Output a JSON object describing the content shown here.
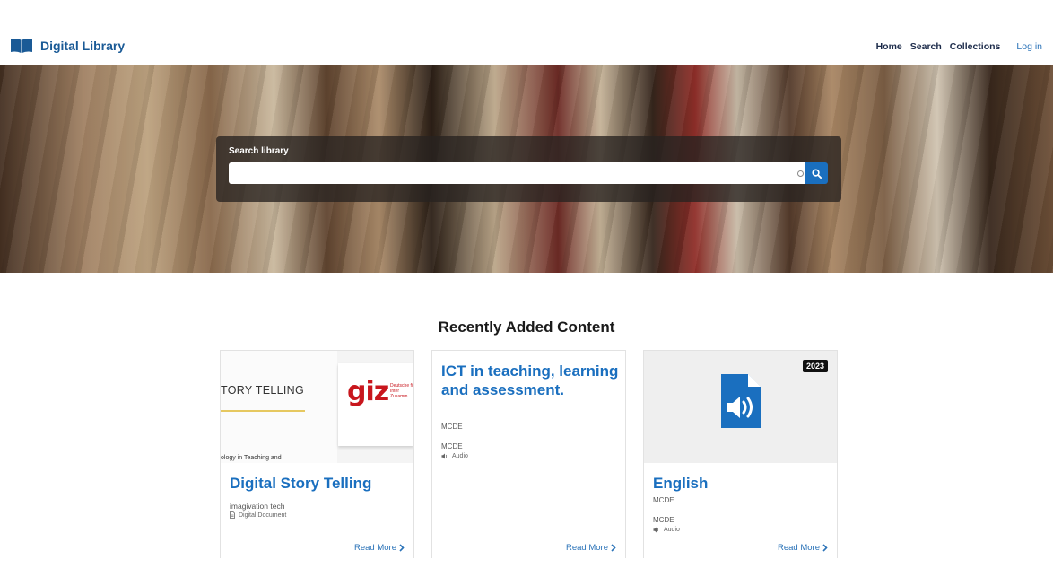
{
  "header": {
    "brand": "Digital Library",
    "nav": {
      "home": "Home",
      "search": "Search",
      "collections": "Collections",
      "login": "Log in"
    }
  },
  "hero": {
    "search_label": "Search library",
    "search_value": "",
    "search_placeholder": ""
  },
  "recent": {
    "title": "Recently Added Content",
    "cards": [
      {
        "thumb_text": "TORY TELLING",
        "thumb_logo": "giz",
        "thumb_logo_sub": "Deutsche für Inter Zusamm",
        "thumb_caption": "ology in Teaching and",
        "title": "Digital Story Telling",
        "author": "imagivation tech",
        "type": "Digital Document",
        "type_icon": "document-icon",
        "read_more": "Read More"
      },
      {
        "title": "ICT in teaching, learning and assessment.",
        "author": "MCDE",
        "author2": "MCDE",
        "type": "Audio",
        "type_icon": "speaker-icon",
        "read_more": "Read More"
      },
      {
        "badge": "2023",
        "thumb_icon": "audio-file-icon",
        "title": "English",
        "author": "MCDE",
        "author2": "MCDE",
        "type": "Audio",
        "type_icon": "speaker-icon",
        "read_more": "Read More"
      }
    ]
  },
  "colors": {
    "brand": "#1a5a96",
    "accent": "#1a6fbf",
    "link": "#2b73b8"
  }
}
